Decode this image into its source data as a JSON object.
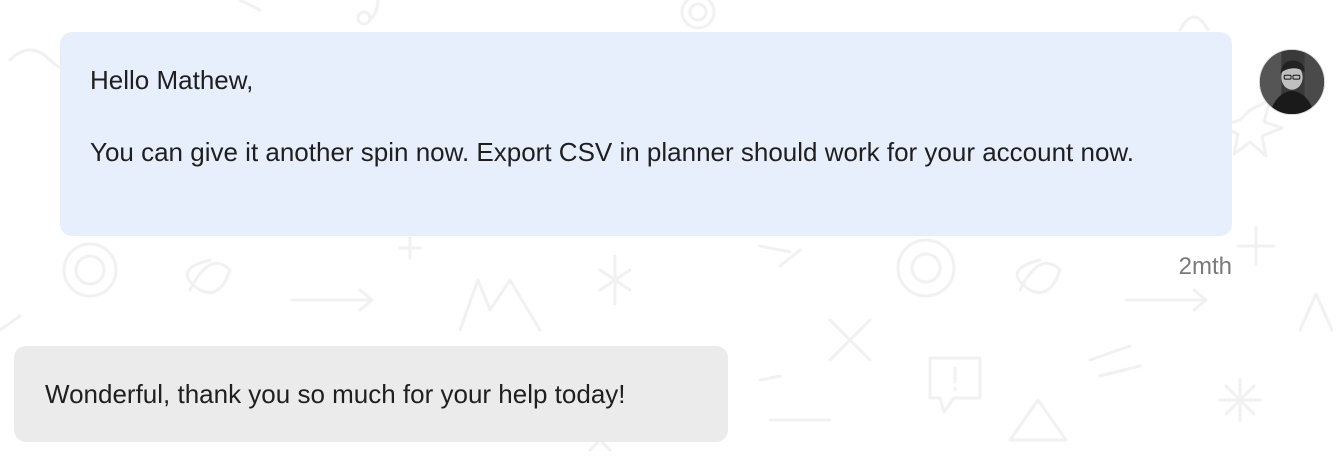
{
  "conversation": {
    "agent_message": {
      "greeting": "Hello Mathew,",
      "body": "You can give it another spin now. Export CSV in planner should work for your account now.",
      "timestamp": "2mth",
      "avatar": "agent-avatar-photo"
    },
    "user_message": {
      "text": "Wonderful, thank you so much for your help today!"
    }
  },
  "colors": {
    "page_background": "#ffffff",
    "agent_bubble": "#e8effc",
    "user_bubble": "#ebebeb",
    "message_text": "#1f1f1f",
    "timestamp_text": "#7a7a7a"
  }
}
